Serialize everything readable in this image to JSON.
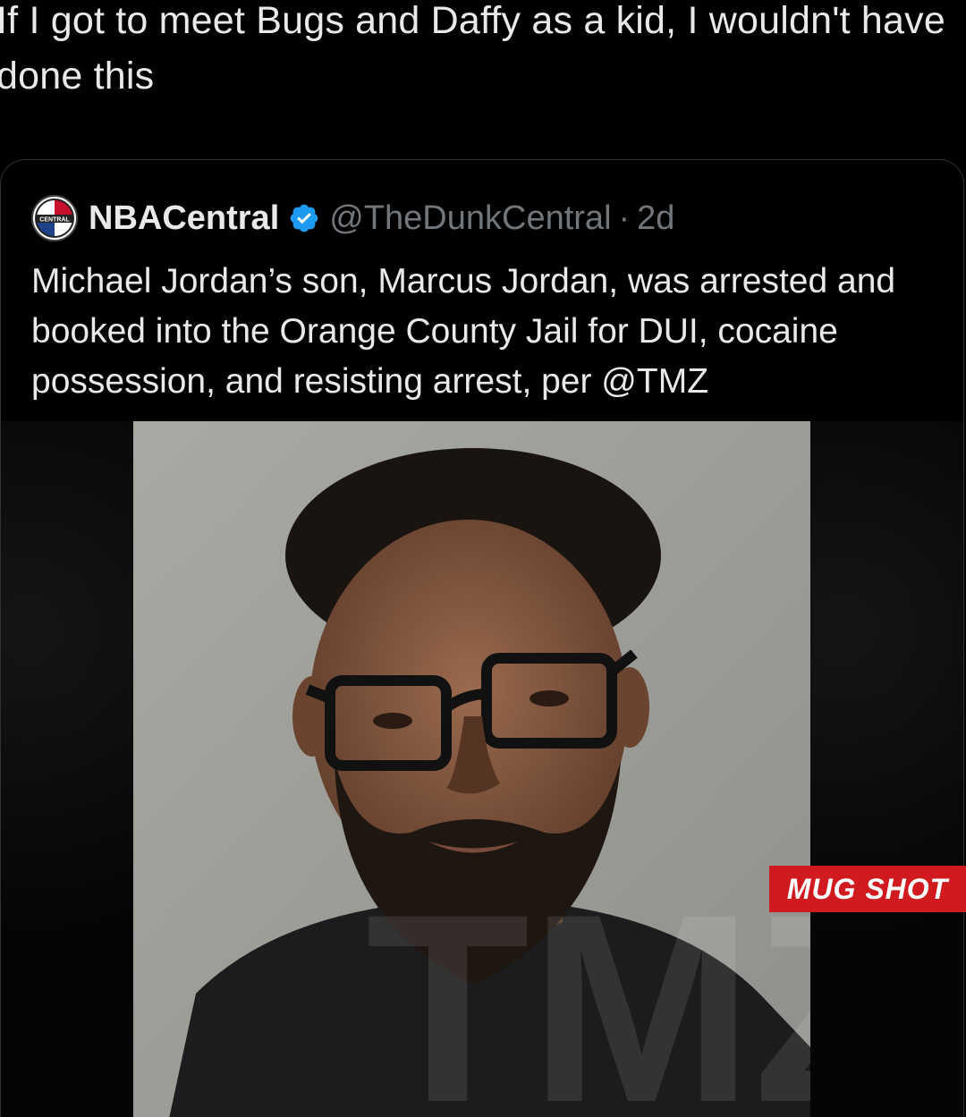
{
  "post": {
    "text": "If I got to meet Bugs and Daffy as a kid, I wouldn't have done this"
  },
  "quoted_tweet": {
    "display_name": "NBACentral",
    "handle": "@TheDunkCentral",
    "separator": "·",
    "age": "2d",
    "verified": true,
    "avatar_text": "CENTRAL",
    "body": "Michael Jordan’s son, Marcus Jordan, was arrested and booked into the Orange County Jail for DUI, cocaine possession, and resisting arrest, per @TMZ",
    "media": {
      "badge_label": "MUG SHOT",
      "watermark": "TMZ"
    }
  },
  "colors": {
    "background": "#000000",
    "text": "#e7e9ea",
    "muted": "#71767b",
    "verified_blue": "#1d9bf0",
    "badge_red": "#d11a1f"
  }
}
